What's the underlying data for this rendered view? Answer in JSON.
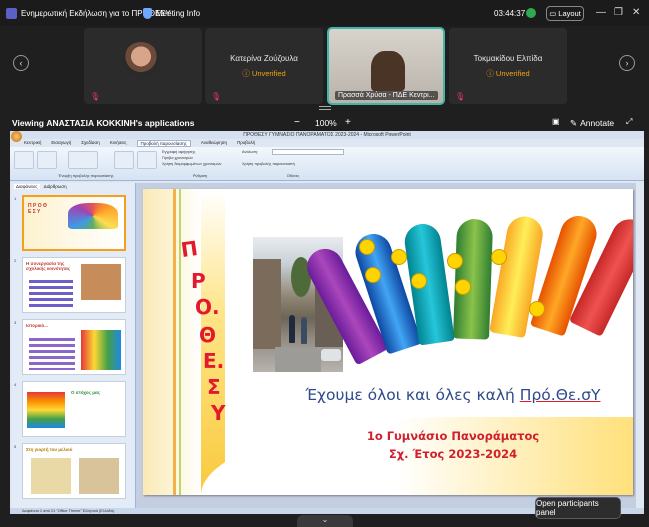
{
  "titlebar": {
    "meeting_title": "Ενημερωτική Εκδήλωση για το ΠΡΟΘΕΣΥ",
    "meeting_info": "Meeting Info",
    "timer": "03:44:37",
    "layout_label": "Layout",
    "min": "—",
    "restore": "❐",
    "close": "✕"
  },
  "participants": [
    {
      "name": "",
      "status": "",
      "type": "avatar"
    },
    {
      "name": "Κατερίνα Ζούζουλα",
      "status": "Unverified",
      "type": "tile"
    },
    {
      "name": "Πρασσά Χρύσα - ΠΔΕ Κεντρι...",
      "status": "",
      "type": "video",
      "active": true
    },
    {
      "name": "Τοκμακίδου Ελπίδα",
      "status": "Unverified",
      "type": "tile"
    }
  ],
  "viewing": {
    "label": "Viewing ΑΝΑΣΤΑΣΙΑ ΚΟΚΚΙΝΗ's applications",
    "zoom": "100%",
    "zoom_minus": "−",
    "zoom_plus": "+",
    "annotate": "Annotate"
  },
  "ppt": {
    "window_title": "ΠΡΟΘΕΣΥ ΓΥΜΝΑΣΙΟ ΠΑΝΟΡΑΜΑΤΟΣ 2023-2024 - Microsoft PowerPoint",
    "tabs": [
      "Κεντρική",
      "Εισαγωγή",
      "Σχεδίαση",
      "Κινήσεις",
      "Προβολή παρουσίασης",
      "Αναθεώρηση",
      "Προβολή"
    ],
    "active_tab": "Προβολή παρουσίασης",
    "ribbon": {
      "group1": "Έναρξη προβολής παρουσίασης",
      "group2": "Ρύθμιση",
      "group3": "Οθόνες",
      "items": [
        "Από την αρχή",
        "Από την τρέχουσα διαφάνεια",
        "Προσαρμοσμένη προβολή παρουσίασης",
        "Ρύθμιση προβολής παρουσίασης",
        "Απόκρυψη διαφάνειας",
        "Εγγραφή αφήγησης",
        "Πρόβα χρονισμών",
        "Χρήση διαμορφωμένων χρονισμών",
        "Ανάλυση:",
        "Χρήση προβολής παρουσιαστή"
      ]
    },
    "panel_tabs": [
      "Διαφάνειες",
      "Διάρθρωση"
    ],
    "thumb_titles": [
      "Π Ρ Ο Θ Ε Σ Υ",
      "Η συνεργασία της σχολικής κοινότητας",
      "Ιστορικό...",
      "Ο στόχος μας",
      "Στη γιορτή του μελιού"
    ],
    "status_text": "Διαφάνεια 1 από 21    \"Office Theme\"    Ελληνικά (Ελλάδα)"
  },
  "slide": {
    "vertical_letters": [
      "Π",
      "Ρ",
      "Ο.",
      "Θ",
      "Ε.",
      "Σ",
      "Υ"
    ],
    "headline_part1": "Έχουμε όλοι και όλες καλή ",
    "headline_part2": "Πρό.Θε.σΥ",
    "school": "1ο Γυμνάσιο Πανοράματος",
    "year": "Σχ. Έτος 2023-2024"
  },
  "participants_panel_tooltip": "Open participants panel",
  "colors": {
    "accent_teal": "#3fb6a8",
    "unverified": "#f0a30a",
    "slide_red": "#d0202e",
    "slide_blue": "#2e4a8c"
  }
}
